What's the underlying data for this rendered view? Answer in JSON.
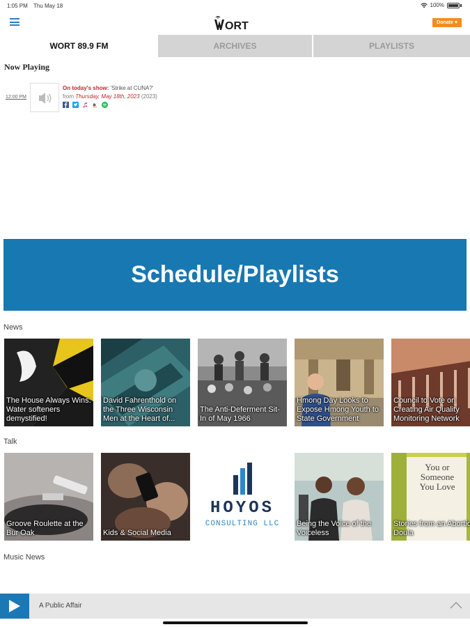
{
  "status_bar": {
    "time": "1:05 PM",
    "date": "Thu May 18",
    "battery": "100%"
  },
  "header": {
    "logo_text": "WORT",
    "donate_label": "Donate ♥"
  },
  "tabs": [
    {
      "label": "WORT 89.9 FM",
      "active": true
    },
    {
      "label": "ARCHIVES",
      "active": false
    },
    {
      "label": "PLAYLISTS",
      "active": false
    }
  ],
  "now_playing": {
    "heading": "Now Playing",
    "time": "12:00 PM",
    "show_label": "On today's show:",
    "show_title": "'Strike at CUNA?'",
    "from_label": "from",
    "from_date": "Thursday, May 18th, 2023",
    "year": "(2023)",
    "share_icons": [
      "facebook-icon",
      "twitter-icon",
      "itunes-icon",
      "amazon-icon",
      "spotify-icon"
    ]
  },
  "schedule_banner": {
    "label": "Schedule/Playlists",
    "color": "#1878b2"
  },
  "sections": {
    "news": {
      "label": "News",
      "cards": [
        {
          "caption": "The House Always Wins: Water softeners demystified!"
        },
        {
          "caption": "David Fahrenthold on the Three Wisconsin Men at the Heart of..."
        },
        {
          "caption": "The Anti-Deferment Sit-In of May 1966"
        },
        {
          "caption": "Hmong Day Looks to Expose Hmong Youth to State Government"
        },
        {
          "caption": "Council to Vote on Creating Air Quality Monitoring Network"
        }
      ]
    },
    "talk": {
      "label": "Talk",
      "cards": [
        {
          "caption": "Groove Roulette at the Bur Oak"
        },
        {
          "caption": "Kids & Social Media"
        },
        {
          "caption": "",
          "logo_name": "HOYOS",
          "logo_sub": "CONSULTING LLC"
        },
        {
          "caption": "Being the Voice of the Voiceless"
        },
        {
          "caption": "Stories from an Abortion Doula",
          "book_title": "You or Someone You Love"
        }
      ]
    },
    "music_news": {
      "label": "Music News"
    }
  },
  "player": {
    "title": "A Public Affair"
  },
  "colors": {
    "accent_blue": "#1c78b5",
    "donate_orange": "#f28c1e",
    "link_red": "#c0262c"
  }
}
